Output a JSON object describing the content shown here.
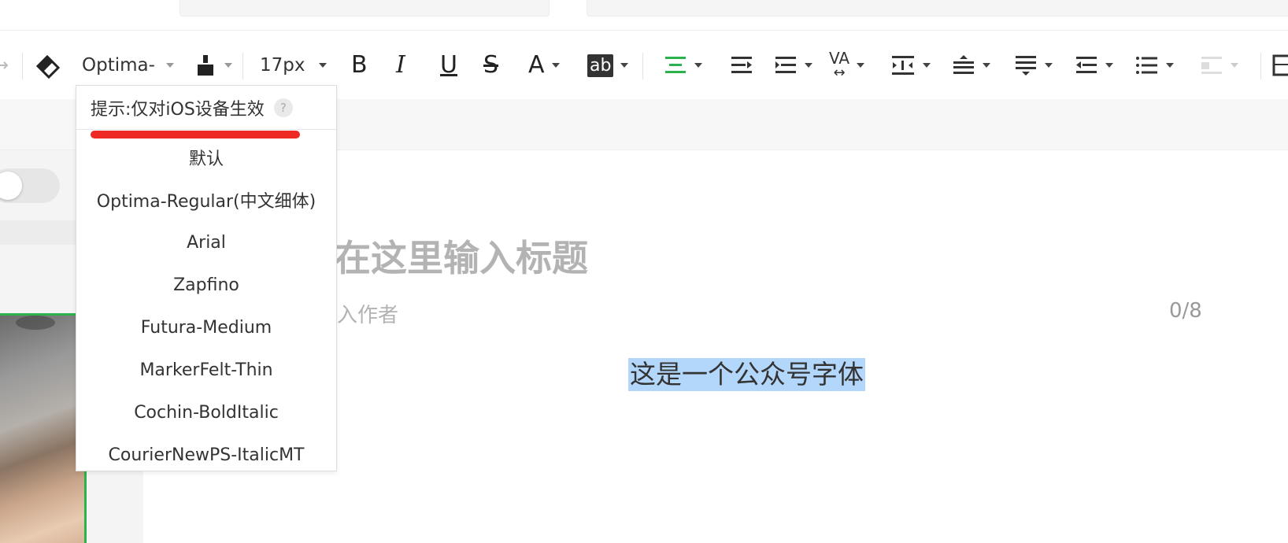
{
  "toolbar": {
    "font_family": "Optima-",
    "font_size": "17px",
    "bold": "B",
    "italic": "I",
    "underline": "U",
    "strike": "S",
    "font_color": "A",
    "bg_color": "ab",
    "letter_spacing": "VA"
  },
  "font_dropdown": {
    "hint": "提示:仅对iOS设备生效",
    "help": "?",
    "options": [
      "默认",
      "Optima-Regular(中文细体)",
      "Arial",
      "Zapfino",
      "Futura-Medium",
      "MarkerFelt-Thin",
      "Cochin-BoldItalic",
      "CourierNewPS-ItalicMT"
    ]
  },
  "editor": {
    "title_placeholder": "在这里输入标题",
    "author_placeholder": "入作者",
    "author_count": "0/8",
    "selected_text": "这是一个公众号字体"
  },
  "colors": {
    "accent_green": "#2bb24c",
    "highlight": "#b3d6fb",
    "annotation_red": "#ee2a24"
  }
}
